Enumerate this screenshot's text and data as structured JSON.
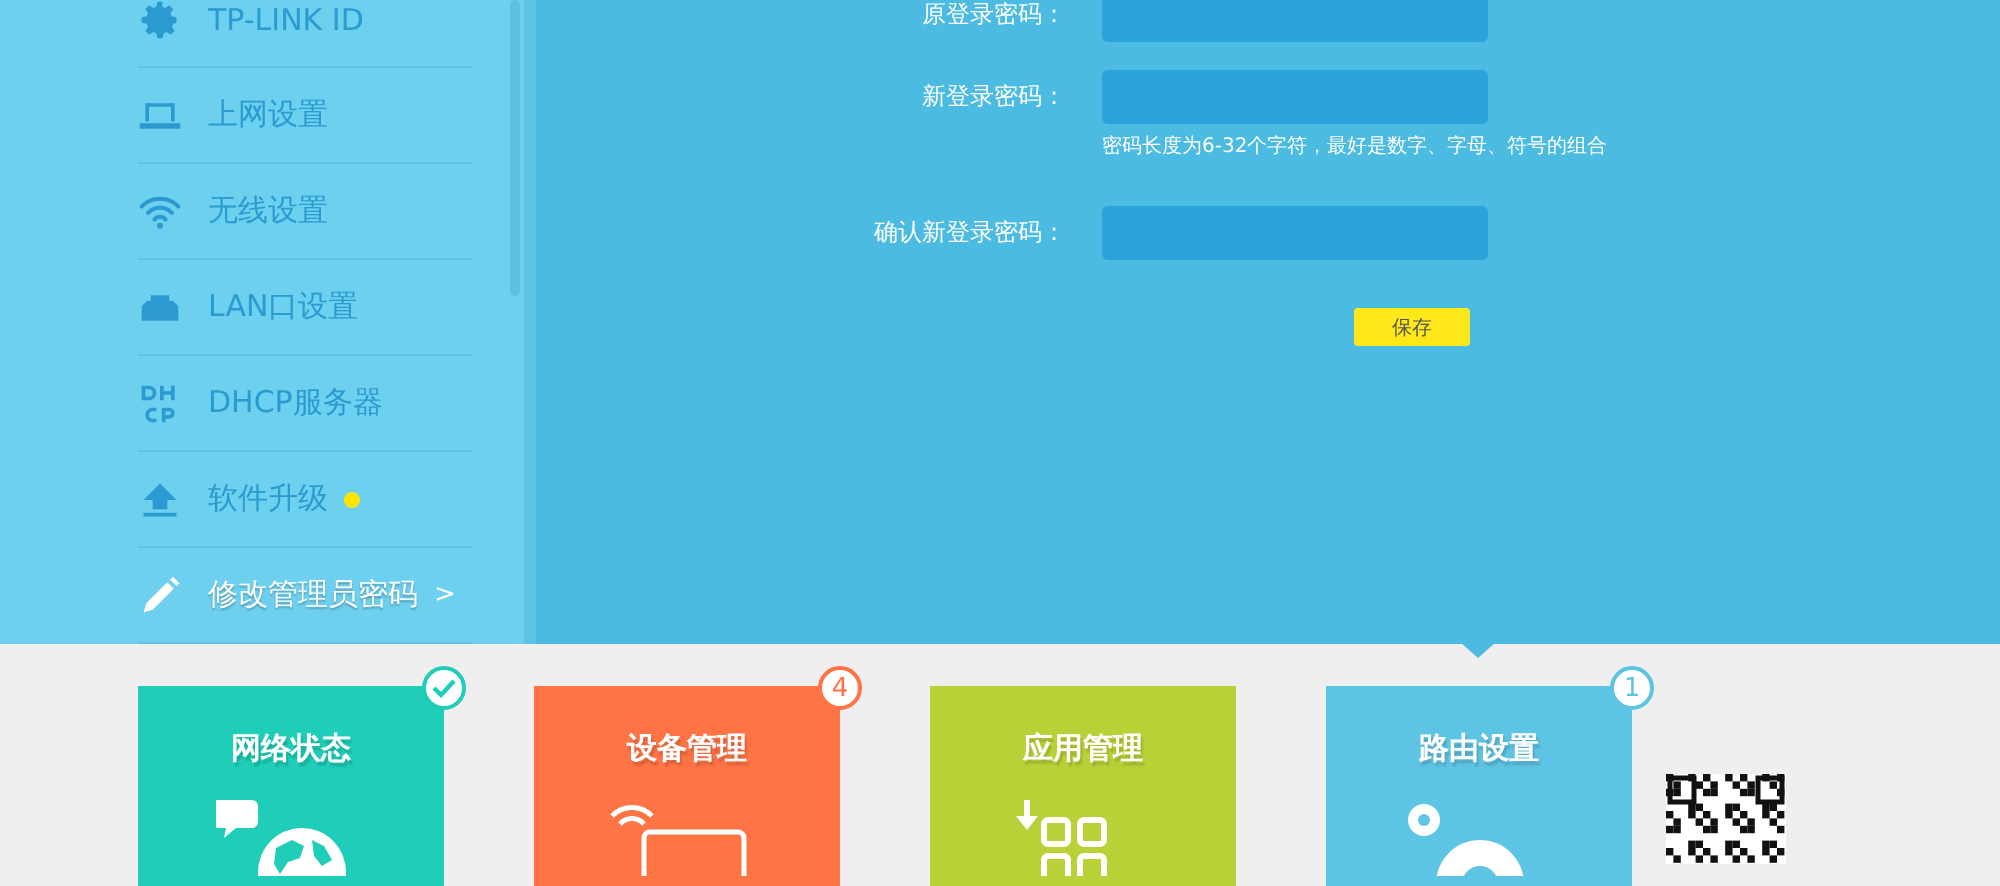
{
  "sidebar": {
    "items": [
      {
        "label": "TP-LINK ID",
        "selected": false,
        "dot": false
      },
      {
        "label": "上网设置",
        "selected": false,
        "dot": false
      },
      {
        "label": "无线设置",
        "selected": false,
        "dot": false
      },
      {
        "label": "LAN口设置",
        "selected": false,
        "dot": false
      },
      {
        "label": "DHCP服务器",
        "selected": false,
        "dot": false
      },
      {
        "label": "软件升级",
        "selected": false,
        "dot": true
      },
      {
        "label": "修改管理员密码",
        "selected": true,
        "dot": false
      }
    ],
    "selected_marker": ">"
  },
  "form": {
    "fields": [
      {
        "label": "原登录密码："
      },
      {
        "label": "新登录密码：",
        "hint": "密码长度为6-32个字符，最好是数字、字母、符号的组合"
      },
      {
        "label": "确认新登录密码："
      }
    ],
    "save_button": "保存"
  },
  "tiles": [
    {
      "label": "网络状态",
      "color": "#1fcdb8",
      "selected": false,
      "badge": {
        "kind": "check"
      }
    },
    {
      "label": "设备管理",
      "color": "#ff7344",
      "selected": false,
      "badge": {
        "kind": "count",
        "text": "4"
      }
    },
    {
      "label": "应用管理",
      "color": "#b8d136",
      "selected": false
    },
    {
      "label": "路由设置",
      "color": "#5ec4e4",
      "selected": true,
      "badge": {
        "kind": "count",
        "text": "1"
      }
    }
  ]
}
